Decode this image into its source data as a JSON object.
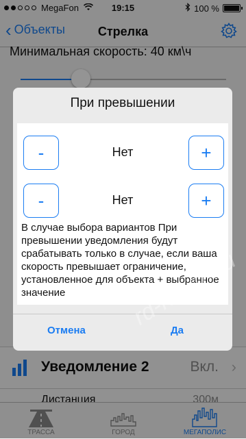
{
  "status_bar": {
    "carrier": "MegaFon",
    "time": "19:15",
    "battery": "100 %"
  },
  "nav": {
    "back_label": "Объекты",
    "title": "Стрелка"
  },
  "background": {
    "min_speed_label": "Минимальная скорость: 40 км\\ч",
    "notification2_label": "Уведомление 2",
    "notification2_value": "Вкл.",
    "distance_label": "Дистанция",
    "distance_value": "300м"
  },
  "dialog": {
    "title": "При превышении",
    "stepper1": {
      "minus": "-",
      "value": "Нет",
      "plus": "+"
    },
    "stepper2": {
      "minus": "-",
      "value": "Нет",
      "plus": "+"
    },
    "description": "В случае выбора вариантов При превышении уведомления будут срабатывать только в случае, если ваша скорость превышает ограничение, установленное для объекта + выбранное значение",
    "cancel_label": "Отмена",
    "ok_label": "Да"
  },
  "tabs": [
    {
      "label": "ТРАССА",
      "active": false
    },
    {
      "label": "ГОРОД",
      "active": false
    },
    {
      "label": "МЕГАПОЛИС",
      "active": true
    }
  ],
  "watermark": "rd-forum.ru",
  "colors": {
    "accent": "#1a7cf2",
    "dialog_background": "#ebebeb"
  }
}
